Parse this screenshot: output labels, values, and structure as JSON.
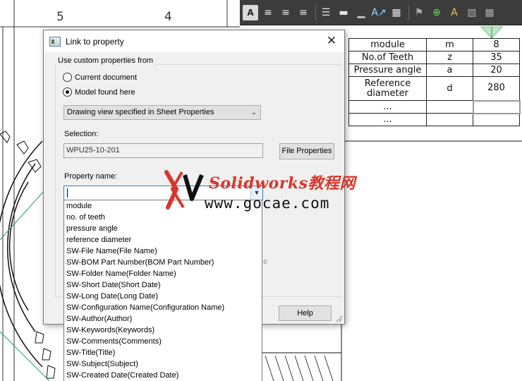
{
  "ruler": {
    "left_number": "5",
    "right_number": "4"
  },
  "toolbar": {
    "icons": [
      "text-a-icon",
      "align-left-icon",
      "align-center-icon",
      "align-right-icon",
      "align-top-icon",
      "align-middle-icon",
      "align-bottom-icon",
      "text-fit-icon",
      "table-icon",
      "tag-icon",
      "add-icon",
      "color-icon",
      "grid-icon",
      "hatch-icon"
    ]
  },
  "gear_table": {
    "rows": [
      [
        "module",
        "m",
        "8"
      ],
      [
        "No.of Teeth",
        "z",
        "35"
      ],
      [
        "Pressure angle",
        "a",
        "20"
      ],
      [
        "Reference diameter",
        "d",
        "280"
      ],
      [
        "...",
        "",
        ""
      ],
      [
        "...",
        "",
        ""
      ]
    ]
  },
  "watermark": {
    "title": "Solidworks教程网",
    "url": "www.gocae.com"
  },
  "dialog": {
    "title": "Link to property",
    "close_symbol": "✕",
    "group_label": "Use custom properties from",
    "radio_current": "Current document",
    "radio_model": "Model found here",
    "selected_radio": "Model found here",
    "view_select_value": "Drawing view specified in Sheet Properties",
    "selection_label": "Selection:",
    "selection_value": "WPU25-10-201",
    "file_properties_button": "File Properties",
    "property_name_label": "Property name:",
    "property_name_value": "",
    "help_button": "Help",
    "ghost_text": "e"
  },
  "property_list": [
    "module",
    "no. of teeth",
    "pressure angle",
    "reference diameter",
    "SW-File Name(File Name)",
    "SW-BOM Part Number(BOM Part Number)",
    "SW-Folder Name(Folder Name)",
    "SW-Short Date(Short Date)",
    "SW-Long Date(Long Date)",
    "SW-Configuration Name(Configuration Name)",
    "SW-Author(Author)",
    "SW-Keywords(Keywords)",
    "SW-Comments(Comments)",
    "SW-Title(Title)",
    "SW-Subject(Subject)",
    "SW-Created Date(Created Date)"
  ],
  "colors": {
    "accent_border": "#3c7fb1",
    "watermark_red": "#d9362b",
    "toolbar_bg": "#3c3c3c"
  }
}
